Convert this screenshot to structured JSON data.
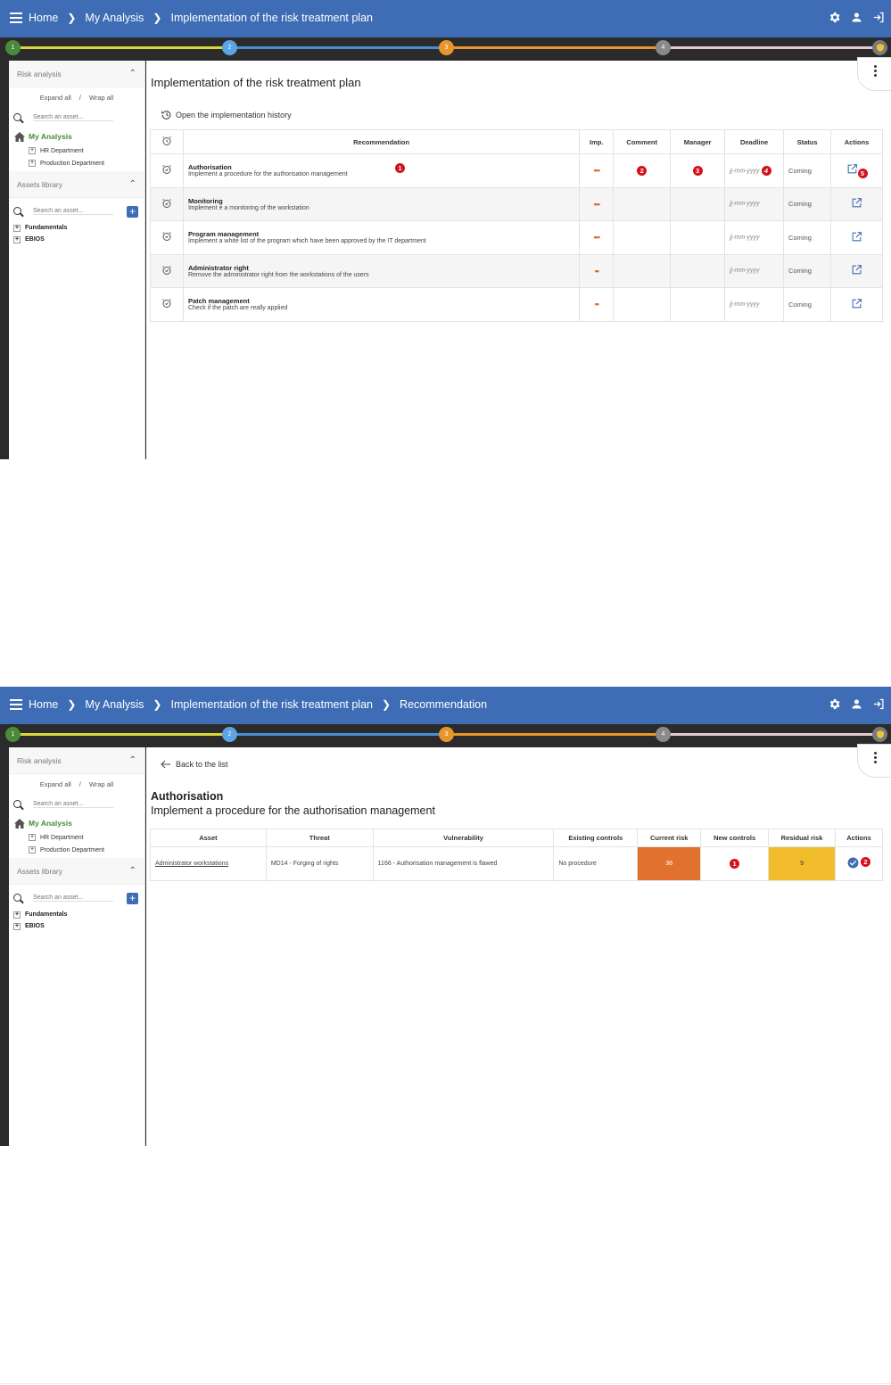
{
  "screen1": {
    "breadcrumbs": [
      "Home",
      "My Analysis",
      "Implementation of the risk treatment plan"
    ],
    "steps": [
      {
        "label": "1",
        "color": "#4a8a3a"
      },
      {
        "label": "2",
        "color": "#5ba4e6"
      },
      {
        "label": "3",
        "color": "#e8962b"
      },
      {
        "label": "4",
        "color": "#8a8a8a"
      }
    ],
    "step_line_colors": [
      "#d9d93a",
      "#4a8fd6",
      "#e8962b",
      "#e6c9d0"
    ],
    "sidebar": {
      "risk_analysis": "Risk analysis",
      "expand_all": "Expand all",
      "slash": "/",
      "wrap_all": "Wrap all",
      "search_placeholder": "Search an asset...",
      "home": "My Analysis",
      "tree": [
        "HR Department",
        "Production Department"
      ],
      "assets_library": "Assets library",
      "library_search_placeholder": "Search an asset...",
      "library": [
        "Fundamentals",
        "EBIOS"
      ]
    },
    "title": "Implementation of the risk treatment plan",
    "history_link": "Open the implementation history",
    "columns": [
      "Recommendation",
      "Imp.",
      "Comment",
      "Manager",
      "Deadline",
      "Status",
      "Actions"
    ],
    "rows": [
      {
        "title": "Authorisation",
        "desc": "Implement a procedure for the authorisation management",
        "imp": "•••",
        "deadline": "jj-mm-yyyy",
        "status": "Coming"
      },
      {
        "title": "Monitoring",
        "desc": "Implement e a monitoring of the workstation",
        "imp": "•••",
        "deadline": "jj-mm-yyyy",
        "status": "Coming"
      },
      {
        "title": "Program management",
        "desc": "Implement a white list of the program which have been approved by the IT department",
        "imp": "•••",
        "deadline": "jj-mm-yyyy",
        "status": "Coming"
      },
      {
        "title": "Administrator right",
        "desc": "Remove the administrator right from the workstations of the users",
        "imp": "••",
        "deadline": "jj-mm-yyyy",
        "status": "Coming"
      },
      {
        "title": "Patch management",
        "desc": "Check if the patch are really applied",
        "imp": "••",
        "deadline": "jj-mm-yyyy",
        "status": "Coming"
      }
    ],
    "badges": [
      "1",
      "2",
      "3",
      "4",
      "5"
    ]
  },
  "screen2": {
    "breadcrumbs": [
      "Home",
      "My Analysis",
      "Implementation of the risk treatment plan",
      "Recommendation"
    ],
    "back_link": "Back to the list",
    "rec_title": "Authorisation",
    "rec_desc": "Implement a procedure for the authorisation management",
    "columns": [
      "Asset",
      "Threat",
      "Vulnerability",
      "Existing controls",
      "Current risk",
      "New controls",
      "Residual risk",
      "Actions"
    ],
    "row": {
      "asset": "Administrator workstations",
      "threat": "MD14 - Forging of rights",
      "vulnerability": "1166 - Authorisation management is flawed",
      "existing_controls": "No procedure",
      "current_risk": "36",
      "residual_risk": "9"
    },
    "badges": [
      "1",
      "2"
    ]
  }
}
